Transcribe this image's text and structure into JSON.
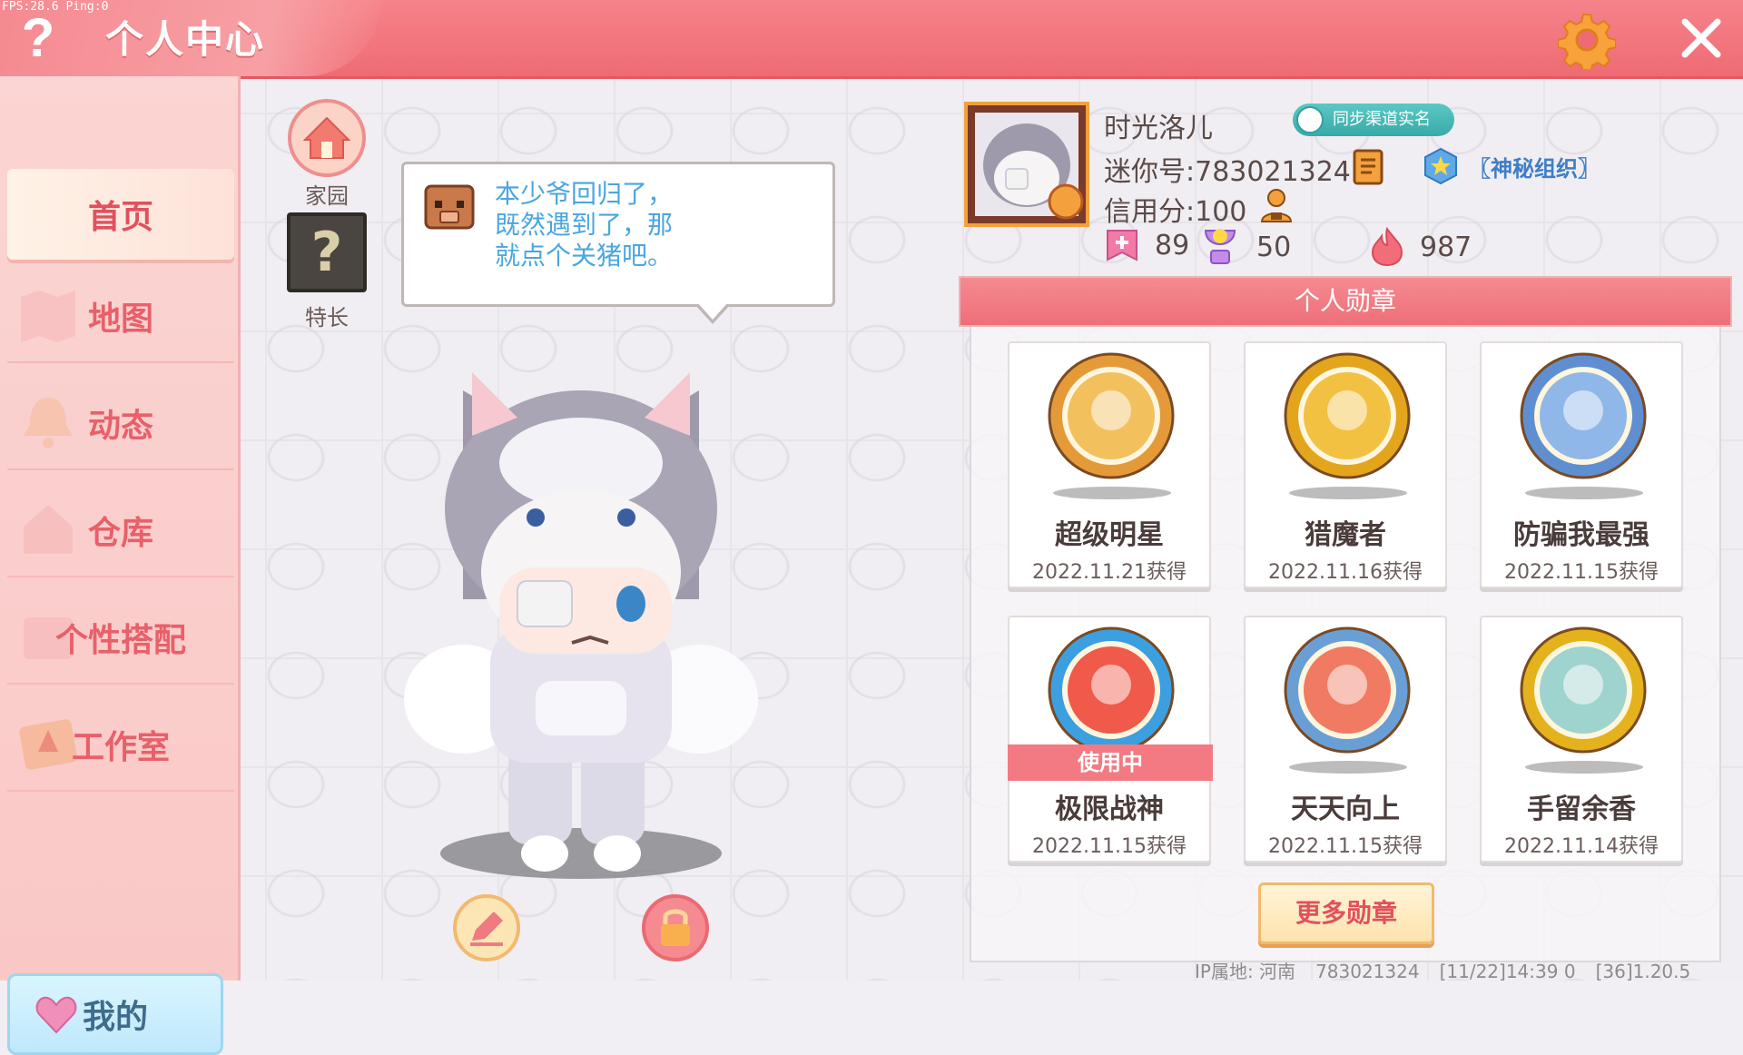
{
  "debug": {
    "fps": "FPS:28.6  Ping:0"
  },
  "header": {
    "title": "个人中心",
    "help_icon": "question-icon",
    "settings_icon": "gear-icon",
    "close_icon": "close-icon"
  },
  "sidebar": {
    "items": [
      {
        "label": "首页",
        "active": true
      },
      {
        "label": "地图",
        "active": false
      },
      {
        "label": "动态",
        "active": false
      },
      {
        "label": "仓库",
        "active": false
      },
      {
        "label": "个性搭配",
        "active": false
      },
      {
        "label": "工作室",
        "active": false
      }
    ],
    "mine_label": "我的"
  },
  "quick_buttons": {
    "home_label": "家园",
    "skill_label": "特长",
    "skill_symbol": "?"
  },
  "bubble": {
    "text": "本少爷回归了，\n既然遇到了，那\n就点个关猪吧。"
  },
  "profile": {
    "nickname": "时光洛儿",
    "realname_badge": "同步渠道实名",
    "mini_id": "迷你号:783021324",
    "org": "〖神秘组织〗",
    "credit": "信用分:100",
    "stats": [
      {
        "icon": "plus-flag-icon",
        "value": "89",
        "color": "#f07aa8"
      },
      {
        "icon": "trophy-icon",
        "value": "50",
        "color": "#b77be6"
      },
      {
        "icon": "flame-icon",
        "value": "987",
        "color": "#f36c7a"
      }
    ]
  },
  "medals": {
    "header": "个人勋章",
    "items": [
      {
        "name": "超级明星",
        "date": "2022.11.21获得",
        "ring": "#e59a3a",
        "inner": "#f2c15e",
        "in_use": false
      },
      {
        "name": "猎魔者",
        "date": "2022.11.16获得",
        "ring": "#e3a51c",
        "inner": "#f2c142",
        "in_use": false
      },
      {
        "name": "防骗我最强",
        "date": "2022.11.15获得",
        "ring": "#5f8fd0",
        "inner": "#8fb7e8",
        "in_use": false
      },
      {
        "name": "极限战神",
        "date": "2022.11.15获得",
        "ring": "#3b9fe0",
        "inner": "#f05a4a",
        "in_use": true
      },
      {
        "name": "天天向上",
        "date": "2022.11.15获得",
        "ring": "#6a9fd6",
        "inner": "#f07a62",
        "in_use": false
      },
      {
        "name": "手留余香",
        "date": "2022.11.14获得",
        "ring": "#e3b21c",
        "inner": "#9fd3ce",
        "in_use": false
      }
    ],
    "in_use_label": "使用中",
    "more_label": "更多勋章"
  },
  "footer": {
    "ip": "IP属地: 河南",
    "uid": "783021324",
    "time": "[11/22]14:39 0",
    "version": "[36]1.20.5"
  }
}
